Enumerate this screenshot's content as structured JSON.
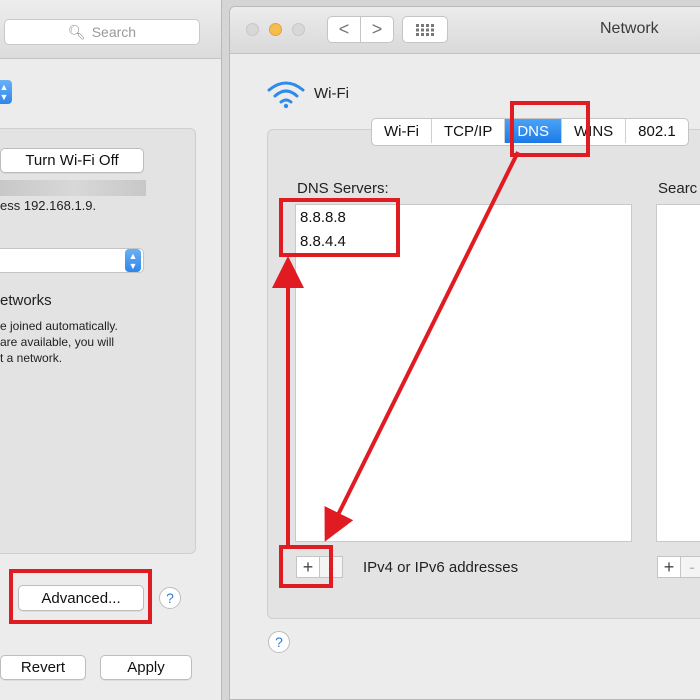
{
  "back_window": {
    "search_placeholder": "Search",
    "turn_wifi_label": "Turn Wi-Fi Off",
    "address_text": "ess 192.168.1.9.",
    "networks_heading": "etworks",
    "networks_desc": [
      "e joined automatically.",
      "are available, you will",
      "t a network."
    ],
    "advanced_label": "Advanced...",
    "help_label": "?",
    "revert_label": "Revert",
    "apply_label": "Apply"
  },
  "front_window": {
    "title": "Network",
    "nav_back": "<",
    "nav_forward": ">",
    "grid_icon": "grid-icon",
    "wifi_label": "Wi-Fi",
    "tabs": [
      {
        "label": "Wi-Fi",
        "selected": false
      },
      {
        "label": "TCP/IP",
        "selected": false
      },
      {
        "label": "DNS",
        "selected": true
      },
      {
        "label": "WINS",
        "selected": false
      },
      {
        "label": "802.1",
        "selected": false
      }
    ],
    "dns_heading": "DNS Servers:",
    "dns_servers": [
      "8.8.8.8",
      "8.8.4.4"
    ],
    "search_heading": "Searc",
    "add_label": "+",
    "remove_label": "-",
    "dns_hint": "IPv4 or IPv6 addresses",
    "help_label": "?"
  },
  "colors": {
    "annotation_red": "#e01b22",
    "accent_blue": "#1c7ae6",
    "traffic_close": "#d8d8d8",
    "traffic_minimize": "#f5bd4f"
  }
}
